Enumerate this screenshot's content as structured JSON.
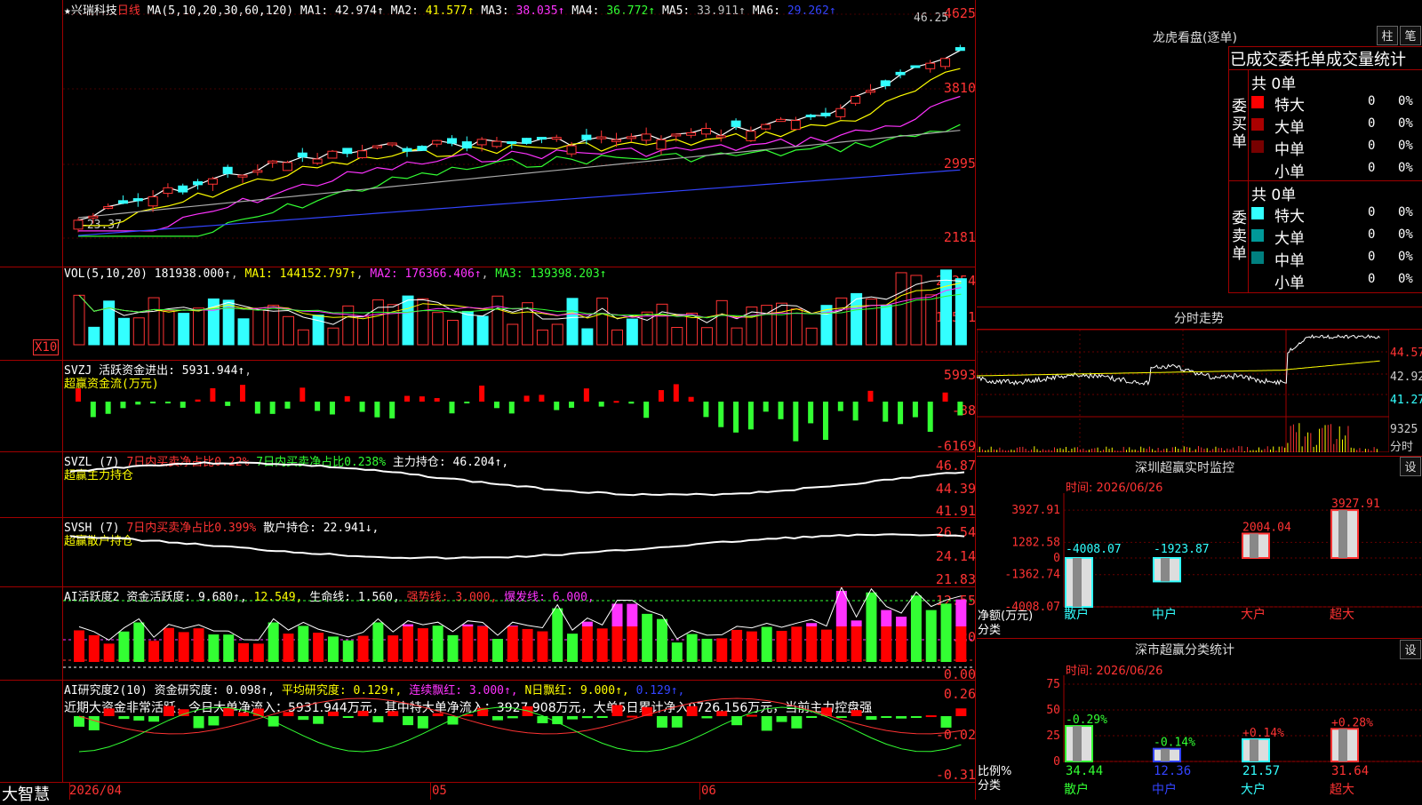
{
  "stock": {
    "star": "★",
    "name": "兴瑞科技",
    "period": "日线"
  },
  "main": {
    "ma_label": "MA(5,10,20,30,60,120)",
    "ma": [
      {
        "name": "MA1:",
        "value": "42.974↑",
        "color": "#ffffff"
      },
      {
        "name": "MA2:",
        "value": "41.577↑",
        "color": "#ffff00"
      },
      {
        "name": "MA3:",
        "value": "38.035↑",
        "color": "#ff33ff"
      },
      {
        "name": "MA4:",
        "value": "36.772↑",
        "color": "#33ff33"
      },
      {
        "name": "MA5:",
        "value": "33.911↑",
        "color": "#c0c0c0"
      },
      {
        "name": "MA6:",
        "value": "29.262↑",
        "color": "#3344ff"
      }
    ],
    "axis": [
      "4625",
      "3810",
      "2995",
      "2181"
    ],
    "high_label": "46.25",
    "low_label": "23.37"
  },
  "vol": {
    "label": "VOL(5,10,20)",
    "value": "181938.000↑",
    "ma1": "MA1: 144152.797↑",
    "ma2": "MA2: 176366.406↑",
    "ma3": "MA3: 139398.203↑",
    "axis": [
      "25354",
      "12521"
    ],
    "unit": "X10"
  },
  "svzj": {
    "label": "SVZJ",
    "title": "活跃资金进出: 5931.944↑",
    "sub": "超赢资金流(万元)",
    "axis": [
      "5993",
      "-88",
      "-6169"
    ]
  },
  "svzl": {
    "label": "SVZL (7)",
    "t1": "7日内买卖净占比0.22%",
    "t2": "7日内买卖净占比0.238%",
    "t3": "主力持仓: 46.204↑,",
    "sub": "超赢主力持仓",
    "axis": [
      "46.87",
      "44.39",
      "41.91"
    ]
  },
  "svsh": {
    "label": "SVSH (7)",
    "t1": "7日内买卖净占比0.399%",
    "t3": "散户持仓: 22.941↓,",
    "sub": "超赢散户持仓",
    "axis": [
      "26.54",
      "24.14",
      "21.83"
    ]
  },
  "ai1": {
    "label": "AI活跃度2",
    "t1": "资金活跃度: 9.680↑,",
    "t2": "12.549,",
    "t3": "生命线: 1.560,",
    "t4": "强势线: 3.000,",
    "t5": "爆发线: 6.000,",
    "axis": [
      "12.55",
      "6.20",
      "0.00"
    ]
  },
  "ai2": {
    "label": "AI研究度2(10)",
    "t1": "资金研究度: 0.098↑,",
    "t2": "平均研究度: 0.129↑,",
    "t3": "连续飘红: 3.000↑,",
    "t4": "N日飘红: 9.000↑,",
    "t5": "0.129↑,",
    "note": "近期大资金非常活跃，今日大单净流入：5931.944万元，其中特大单净流入：3927.908万元，大单5日累计净入9726.156万元，当前主力控盘强",
    "axis": [
      "0.26",
      "-0.02",
      "-0.31"
    ]
  },
  "xaxis": {
    "d1": "2026/04",
    "d2": "05",
    "d3": "06"
  },
  "footer": {
    "brand": "大智慧"
  },
  "lhb": {
    "title": "龙虎看盘(逐单)",
    "btn1": "柱",
    "btn2": "笔",
    "header": "已成交委托单成交量统计",
    "buy_title": "委买单",
    "sell_title": "委卖单",
    "buy_total": "共 0单",
    "sell_total": "共 0单",
    "buy_rows": [
      {
        "name": "特大",
        "count": "0",
        "pct": "0%",
        "color": "#ff0000"
      },
      {
        "name": "大单",
        "count": "0",
        "pct": "0%",
        "color": "#aa0000"
      },
      {
        "name": "中单",
        "count": "0",
        "pct": "0%",
        "color": "#770000"
      },
      {
        "name": "小单",
        "count": "0",
        "pct": "0%",
        "color": "#000000"
      }
    ],
    "sell_rows": [
      {
        "name": "特大",
        "count": "0",
        "pct": "0%",
        "color": "#33ffff"
      },
      {
        "name": "大单",
        "count": "0",
        "pct": "0%",
        "color": "#009999"
      },
      {
        "name": "中单",
        "count": "0",
        "pct": "0%",
        "color": "#008080"
      },
      {
        "name": "小单",
        "count": "0",
        "pct": "0%",
        "color": "#000000"
      }
    ]
  },
  "fenshi": {
    "title": "分时走势",
    "axis": [
      "44.57",
      "42.92",
      "41.27"
    ],
    "vol_label": "9325",
    "unit": "分时"
  },
  "monitor": {
    "title": "深圳超赢实时监控",
    "btn": "设",
    "time": "时间: 2026/06/26",
    "axis": [
      "3927.91",
      "1282.58",
      "0",
      "-1362.74",
      "-4008.07"
    ],
    "ylabel1": "净额(万元)",
    "ylabel2": "分类",
    "cats": [
      "散户",
      "中户",
      "大户",
      "超大"
    ],
    "values": [
      "-4008.07",
      "-1923.87",
      "2004.04",
      "3927.91"
    ]
  },
  "stat": {
    "title": "深市超赢分类统计",
    "btn": "设",
    "time": "时间: 2026/06/26",
    "axis": [
      "75",
      "50",
      "25",
      "0"
    ],
    "ylabel1": "比例%",
    "ylabel2": "分类",
    "cats": [
      "散户",
      "中户",
      "大户",
      "超大"
    ],
    "pcts": [
      "-0.29%",
      "-0.14%",
      "+0.14%",
      "+0.28%"
    ],
    "vals": [
      "34.44",
      "12.36",
      "21.57",
      "31.64"
    ]
  },
  "chart_data": {
    "type": "candlestick",
    "title": "兴瑞科技 日线",
    "y_range": [
      2181,
      4625
    ],
    "high": 46.25,
    "low": 23.37,
    "monitor_values": [
      -4008.07,
      -1923.87,
      2004.04,
      3927.91
    ],
    "stat_values": [
      34.44,
      12.36,
      21.57,
      31.64
    ]
  }
}
